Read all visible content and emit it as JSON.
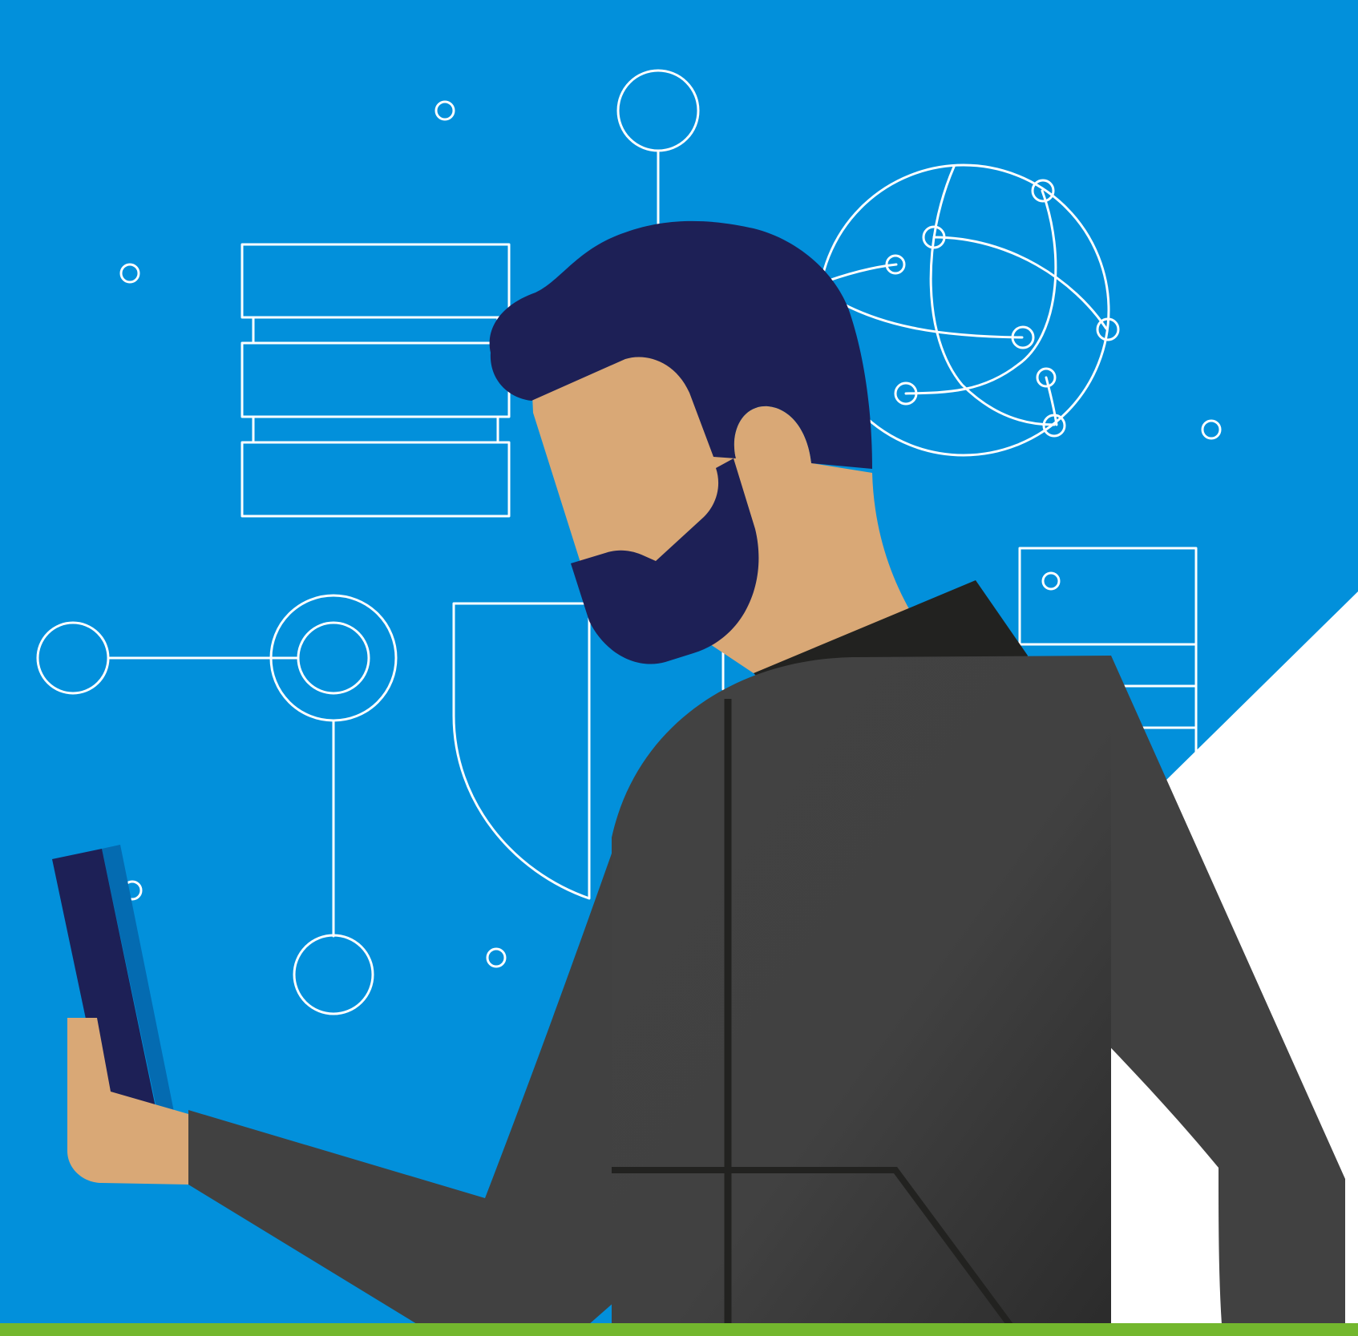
{
  "illustration": {
    "subject": "man-with-smartphone",
    "background_icons": [
      "database-icon",
      "network-node-icon",
      "shield-icon",
      "globe-network-icon",
      "server-rack-icon"
    ]
  },
  "colors": {
    "background_blue": "#0290DB",
    "white_corner": "#FFFFFF",
    "hair_beard": "#1D2056",
    "skin": "#D9A876",
    "jacket": "#414141",
    "jacket_dark": "#2C2C2C",
    "collar": "#222220",
    "phone_front": "#1D2056",
    "phone_side": "#046BB1",
    "bottom_bar": "#73B72E",
    "line_art": "#FFFFFF"
  }
}
